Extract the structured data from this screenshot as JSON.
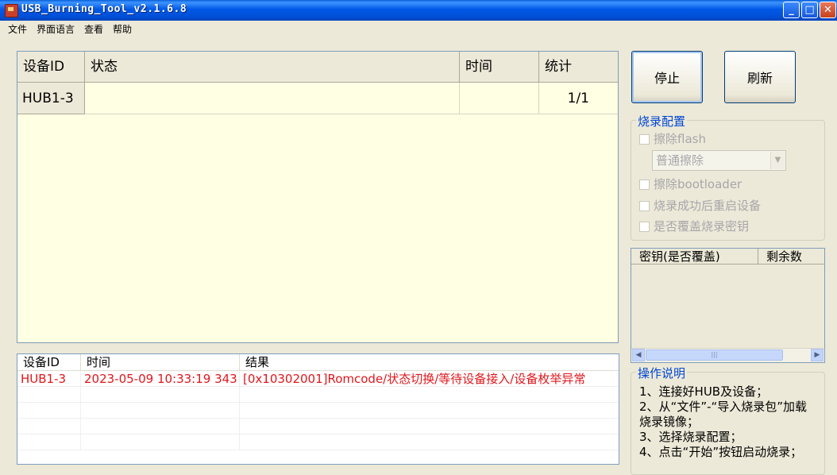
{
  "window": {
    "title": "USB_Burning_Tool_v2.1.6.8",
    "controls": {
      "minimize": "_",
      "maximize": "□",
      "close": "✕"
    }
  },
  "menu": [
    "文件",
    "界面语言",
    "查看",
    "帮助"
  ],
  "device_table": {
    "columns": [
      "设备ID",
      "状态",
      "时间",
      "统计"
    ],
    "rows": [
      {
        "id": "HUB1-3",
        "status": "",
        "time": "",
        "stats": "1/1"
      }
    ]
  },
  "buttons": {
    "stop": "停止",
    "refresh": "刷新"
  },
  "burn_config": {
    "title": "烧录配置",
    "erase_flash": "擦除flash",
    "erase_mode": "普通擦除",
    "erase_bootloader": "擦除bootloader",
    "reboot_after": "烧录成功后重启设备",
    "overwrite_key": "是否覆盖烧录密钥"
  },
  "key_list": {
    "columns": [
      "密钥(是否覆盖)",
      "剩余数"
    ]
  },
  "log_table": {
    "columns": [
      "设备ID",
      "时间",
      "结果"
    ],
    "rows": [
      {
        "id": "HUB1-3",
        "time": "2023-05-09 10:33:19 343",
        "result": "[0x10302001]Romcode/状态切换/等待设备接入/设备枚举异常"
      }
    ]
  },
  "instructions": {
    "title": "操作说明",
    "lines": [
      "1、连接好HUB及设备；",
      "2、从“文件”-“导入烧录包”加载",
      "烧录镜像；",
      "3、选择烧录配置；",
      "4、点击“开始”按钮启动烧录；"
    ]
  },
  "colors": {
    "titlebar": "#0058e6",
    "table_bg": "#ffffe3",
    "log_error": "#e0171c",
    "group_title": "#0046d5"
  }
}
